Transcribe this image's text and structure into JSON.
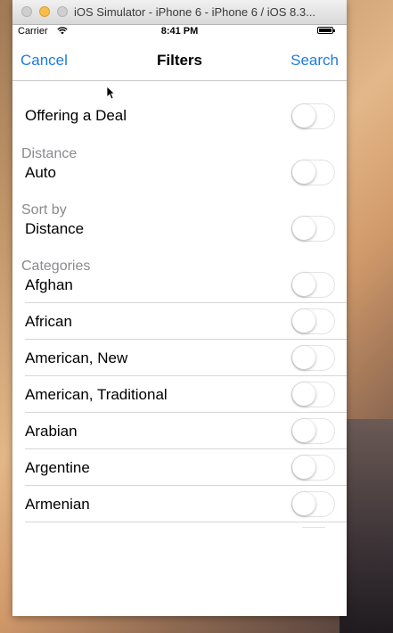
{
  "window": {
    "title": "iOS Simulator - iPhone 6 - iPhone 6 / iOS 8.3..."
  },
  "status_bar": {
    "carrier": "Carrier",
    "time": "8:41 PM",
    "icons": [
      "wifi-icon",
      "battery-icon"
    ]
  },
  "nav": {
    "cancel_label": "Cancel",
    "title": "Filters",
    "search_label": "Search"
  },
  "filters": {
    "deal": {
      "label": "Offering a Deal",
      "on": false
    },
    "distance": {
      "header": "Distance",
      "label": "Auto",
      "on": false
    },
    "sort": {
      "header": "Sort by",
      "label": "Distance",
      "on": false
    },
    "categories": {
      "header": "Categories",
      "items": [
        {
          "label": "Afghan",
          "on": false
        },
        {
          "label": "African",
          "on": false
        },
        {
          "label": "American, New",
          "on": false
        },
        {
          "label": "American, Traditional",
          "on": false
        },
        {
          "label": "Arabian",
          "on": false
        },
        {
          "label": "Argentine",
          "on": false
        },
        {
          "label": "Armenian",
          "on": false
        }
      ]
    }
  },
  "colors": {
    "accent": "#1d7bdc",
    "section_header": "#8a8a8f",
    "separator": "#d6d6d8",
    "switch_border": "#e3e3e3"
  }
}
